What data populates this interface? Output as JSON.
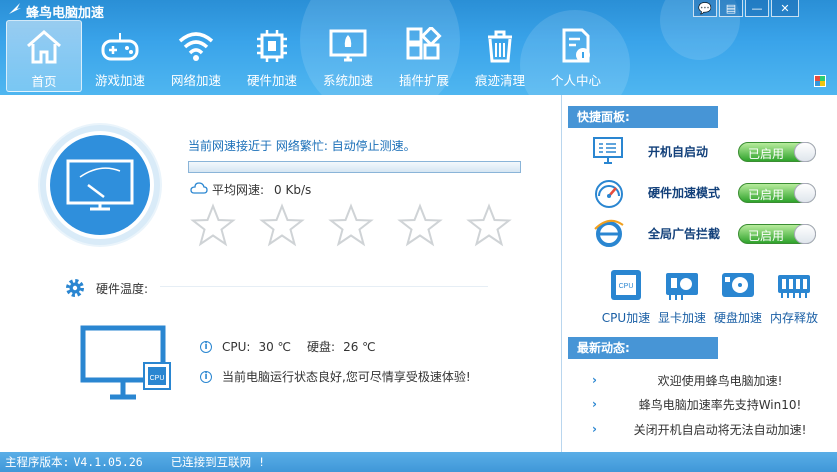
{
  "window": {
    "title": "蜂鸟电脑加速",
    "controls": [
      "feedback-icon",
      "menu-icon",
      "minimize-icon",
      "close-icon"
    ]
  },
  "nav": [
    {
      "label": "首页",
      "icon": "home-icon",
      "active": true
    },
    {
      "label": "游戏加速",
      "icon": "gamepad-icon",
      "active": false
    },
    {
      "label": "网络加速",
      "icon": "wifi-icon",
      "active": false
    },
    {
      "label": "硬件加速",
      "icon": "chip-icon",
      "active": false
    },
    {
      "label": "系统加速",
      "icon": "rocket-screen-icon",
      "active": false
    },
    {
      "label": "插件扩展",
      "icon": "plugins-icon",
      "active": false
    },
    {
      "label": "痕迹清理",
      "icon": "trash-icon",
      "active": false
    },
    {
      "label": "个人中心",
      "icon": "user-document-icon",
      "active": false
    }
  ],
  "speed": {
    "status": "当前网速接近于 网络繁忙: 自动停止测速。",
    "avg_label": "平均网速:",
    "avg_value": "0 Kb/s",
    "stars_total": 5,
    "stars_filled": 0
  },
  "hardware": {
    "temp_label": "硬件温度:",
    "cpu_label": "CPU:",
    "cpu_value": "30 ℃",
    "disk_label": "硬盘:",
    "disk_value": "26 ℃",
    "message": "当前电脑运行状态良好,您可尽情享受极速体验!"
  },
  "quick_panel": {
    "title": "快捷面板:",
    "items": [
      {
        "label": "开机自启动",
        "icon": "startup-icon",
        "toggle": "已启用"
      },
      {
        "label": "硬件加速模式",
        "icon": "gauge-icon",
        "toggle": "已启用"
      },
      {
        "label": "全局广告拦截",
        "icon": "ie-icon",
        "toggle": "已启用"
      }
    ]
  },
  "tools": [
    {
      "label": "CPU加速",
      "icon": "cpu-icon"
    },
    {
      "label": "显卡加速",
      "icon": "gpu-icon"
    },
    {
      "label": "硬盘加速",
      "icon": "hdd-icon"
    },
    {
      "label": "内存释放",
      "icon": "ram-icon"
    }
  ],
  "news": {
    "title": "最新动态:",
    "items": [
      "欢迎使用蜂鸟电脑加速!",
      "蜂鸟电脑加速率先支持Win10!",
      "关闭开机自启动将无法自动加速!"
    ]
  },
  "status_bar": {
    "version_label": "主程序版本:",
    "version": "V4.1.05.26",
    "connection": "已连接到互联网 !"
  },
  "colors": {
    "accent": "#2a86d1",
    "header": "#3aa4ea",
    "toggle_on": "#2fa32c"
  }
}
